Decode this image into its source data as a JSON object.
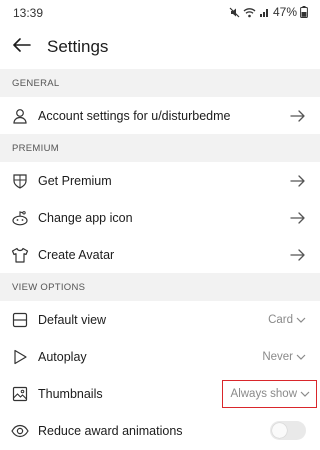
{
  "status_bar": {
    "time": "13:39",
    "battery": "47%"
  },
  "header": {
    "title": "Settings"
  },
  "sections": {
    "general": "GENERAL",
    "premium": "PREMIUM",
    "view_options": "VIEW OPTIONS"
  },
  "rows": {
    "account": {
      "label": "Account settings for u/disturbedme",
      "icon": "person-icon"
    },
    "get_premium": {
      "label": "Get Premium",
      "icon": "shield-icon"
    },
    "change_icon": {
      "label": "Change app icon",
      "icon": "alien-icon"
    },
    "create_avatar": {
      "label": "Create Avatar",
      "icon": "shirt-icon"
    },
    "default_view": {
      "label": "Default view",
      "value": "Card",
      "icon": "card-view-icon"
    },
    "autoplay": {
      "label": "Autoplay",
      "value": "Never",
      "icon": "play-icon"
    },
    "thumbnails": {
      "label": "Thumbnails",
      "value": "Always show",
      "icon": "image-icon"
    },
    "reduce_award": {
      "label": "Reduce award animations",
      "icon": "eye-icon",
      "enabled": false
    }
  },
  "colors": {
    "highlight_border": "#d9262b",
    "section_bg": "#f2f2f2"
  }
}
